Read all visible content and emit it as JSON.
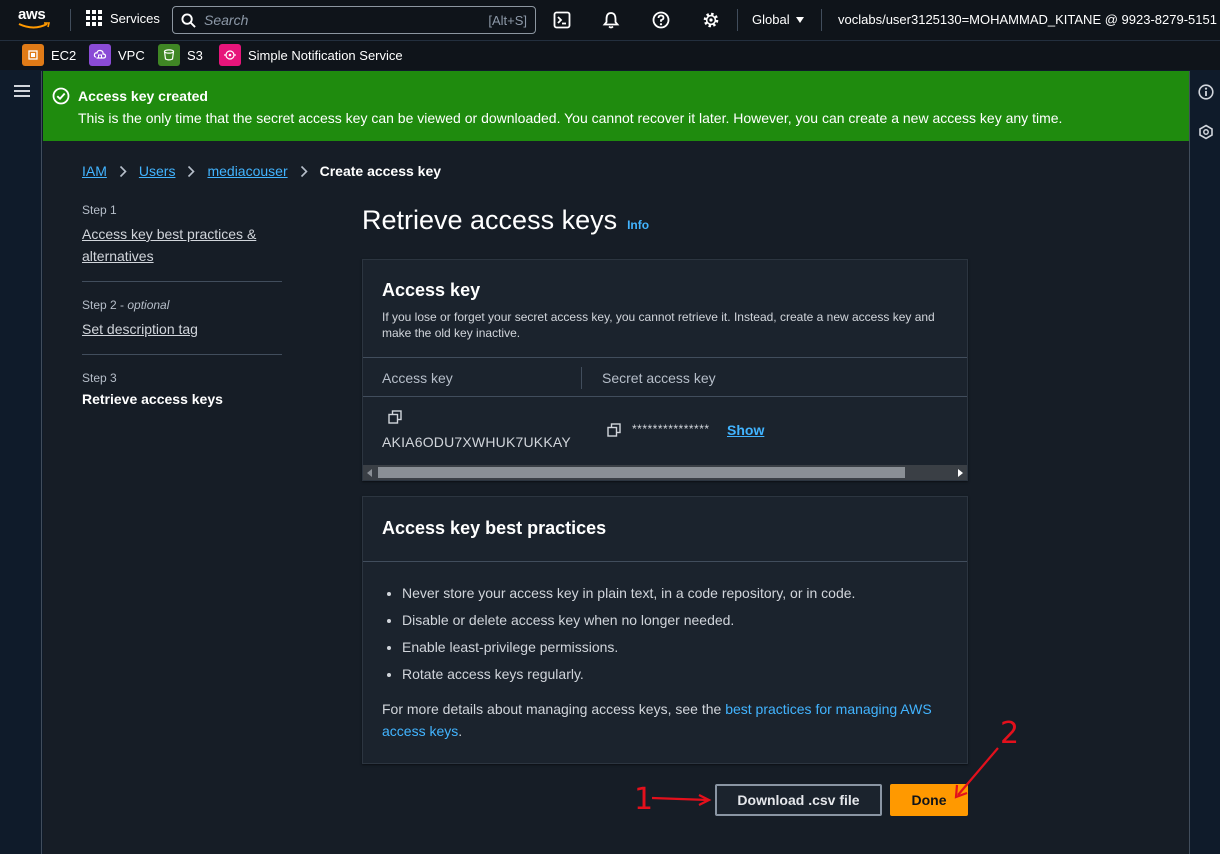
{
  "topnav": {
    "logo_text": "aws",
    "services_label": "Services",
    "search_placeholder": "Search",
    "search_shortcut": "[Alt+S]",
    "region_label": "Global",
    "account_label": "voclabs/user3125130=MOHAMMAD_KITANE @ 9923-8279-5151",
    "icons": [
      "cloudshell-icon",
      "bell-icon",
      "help-icon",
      "gear-icon"
    ]
  },
  "favorites": [
    {
      "label": "EC2",
      "color": "#e07b17"
    },
    {
      "label": "VPC",
      "color": "#8a4bd6"
    },
    {
      "label": "S3",
      "color": "#3f8624"
    },
    {
      "label": "Simple Notification Service",
      "color": "#e7157b"
    }
  ],
  "flash": {
    "title": "Access key created",
    "message": "This is the only time that the secret access key can be viewed or downloaded. You cannot recover it later. However, you can create a new access key any time.",
    "color": "#1f8b0e"
  },
  "breadcrumb": {
    "items": [
      "IAM",
      "Users",
      "mediacouser"
    ],
    "current": "Create access key"
  },
  "steps": [
    {
      "num": "Step 1",
      "optional": "",
      "label": "Access key best practices & alternatives"
    },
    {
      "num": "Step 2 - ",
      "optional": "optional",
      "label": "Set description tag"
    },
    {
      "num": "Step 3",
      "optional": "",
      "label": "Retrieve access keys"
    }
  ],
  "page": {
    "title": "Retrieve access keys",
    "info_label": "Info"
  },
  "access_key_panel": {
    "title": "Access key",
    "description": "If you lose or forget your secret access key, you cannot retrieve it. Instead, create a new access key and make the old key inactive.",
    "col_access_key": "Access key",
    "col_secret": "Secret access key",
    "access_key_value": "AKIA6ODU7XWHUK7UKKAY",
    "secret_masked": "***************",
    "show_label": "Show"
  },
  "best_practices": {
    "title": "Access key best practices",
    "items": [
      "Never store your access key in plain text, in a code repository, or in code.",
      "Disable or delete access key when no longer needed.",
      "Enable least-privilege permissions.",
      "Rotate access keys regularly."
    ],
    "more_prefix": "For more details about managing access keys, see the ",
    "more_link": "best practices for managing AWS access keys",
    "more_suffix": "."
  },
  "buttons": {
    "download": "Download .csv file",
    "done": "Done",
    "primary_color": "#ff9900"
  },
  "annotations": {
    "one": "1",
    "two": "2",
    "color": "#e3101c"
  }
}
